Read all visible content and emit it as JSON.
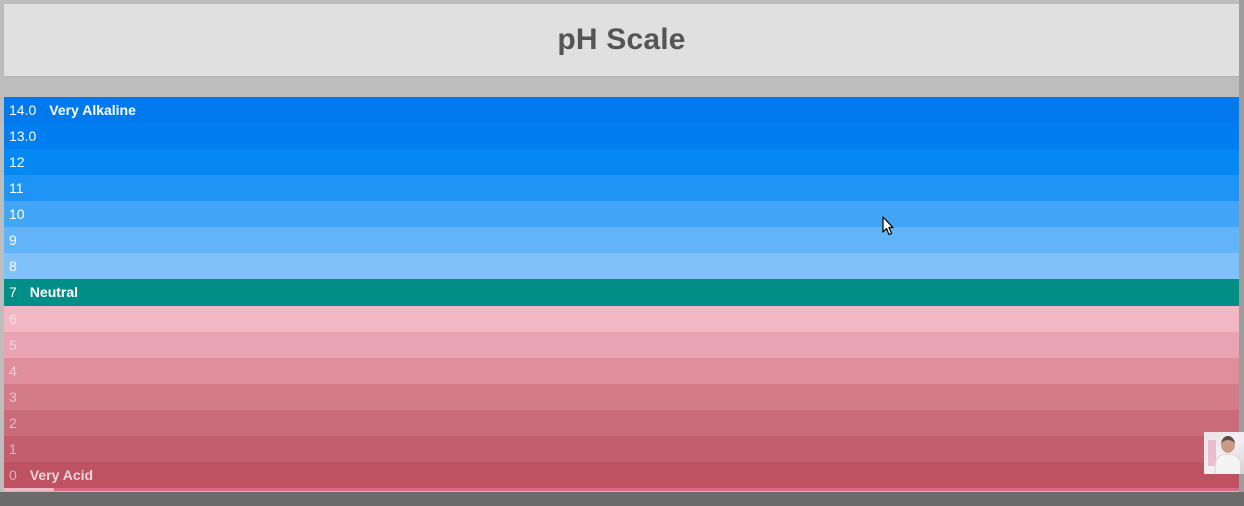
{
  "header": {
    "title": "pH Scale"
  },
  "scale": {
    "rows": [
      {
        "value": "14.0",
        "label": "Very Alkaline",
        "color": "#0079ED"
      },
      {
        "value": "13.0",
        "label": "",
        "color": "#007EF0"
      },
      {
        "value": "12",
        "label": "",
        "color": "#0488F4"
      },
      {
        "value": "11",
        "label": "",
        "color": "#1E95F6"
      },
      {
        "value": "10",
        "label": "",
        "color": "#42A5F6"
      },
      {
        "value": "9",
        "label": "",
        "color": "#60B4F7"
      },
      {
        "value": "8",
        "label": "",
        "color": "#7FC1F8"
      },
      {
        "value": "7",
        "label": "Neutral",
        "color": "#008E87"
      },
      {
        "value": "6",
        "label": "",
        "color": "#F1B7C4"
      },
      {
        "value": "5",
        "label": "",
        "color": "#EAA3B2"
      },
      {
        "value": "4",
        "label": "",
        "color": "#E08D9C"
      },
      {
        "value": "3",
        "label": "",
        "color": "#D47B89"
      },
      {
        "value": "2",
        "label": "",
        "color": "#CA6B7A"
      },
      {
        "value": "1",
        "label": "",
        "color": "#C35E6F"
      },
      {
        "value": "0",
        "label": "Very Acid",
        "color": "#BE5263"
      }
    ]
  },
  "icons": {
    "cursor": "mouse-pointer-icon",
    "webcam": "webcam-thumbnail-icon"
  }
}
